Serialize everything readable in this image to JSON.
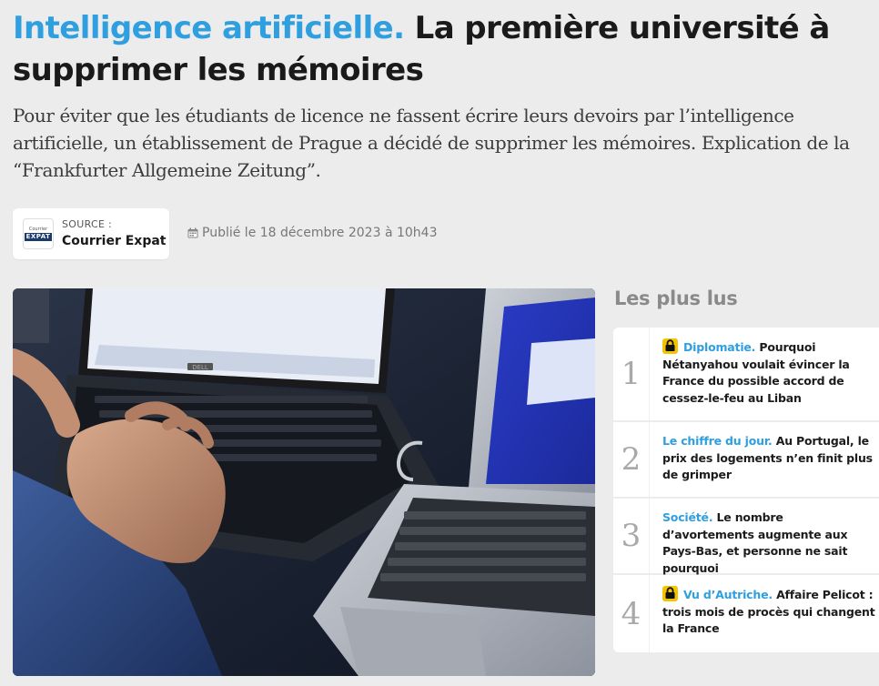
{
  "article": {
    "kicker": "Intelligence artificielle.",
    "title": "La première université à supprimer les mémoires",
    "standfirst": "Pour éviter que les étudiants de licence ne fassent écrire leurs devoirs par l’intelligence artificielle, un établissement de Prague a décidé de supprimer les mémoires. Explication de la “Frankfurter Allgemeine Zeitung”.",
    "source_label": "SOURCE :",
    "source_name": "Courrier Expat",
    "source_logo_top": "Courrier",
    "source_logo_bottom": "EXPAT",
    "published": "Publié le 18 décembre 2023 à 10h43"
  },
  "hero": {
    "laptop_brand": "DELL"
  },
  "most_read": {
    "title": "Les plus lus",
    "items": [
      {
        "num": "1",
        "locked": true,
        "tag": "Diplomatie.",
        "text": "Pourquoi Nétanyahou voulait évincer la France du possible accord de cessez-le-feu au Liban"
      },
      {
        "num": "2",
        "locked": false,
        "tag": "Le chiffre du jour.",
        "text": "Au Portugal, le prix des logements n’en finit plus de grimper"
      },
      {
        "num": "3",
        "locked": false,
        "tag": "Société.",
        "text": "Le nombre d’avortements augmente aux Pays-Bas, et personne ne sait pourquoi"
      },
      {
        "num": "4",
        "locked": true,
        "tag": "Vu d’Autriche.",
        "text": "Affaire Pelicot : trois mois de procès qui changent la France"
      }
    ]
  },
  "colors": {
    "accent": "#2f9fe0",
    "lock": "#f5c400",
    "background": "#ececec"
  },
  "icons": [
    "calendar-icon",
    "lock-icon"
  ]
}
